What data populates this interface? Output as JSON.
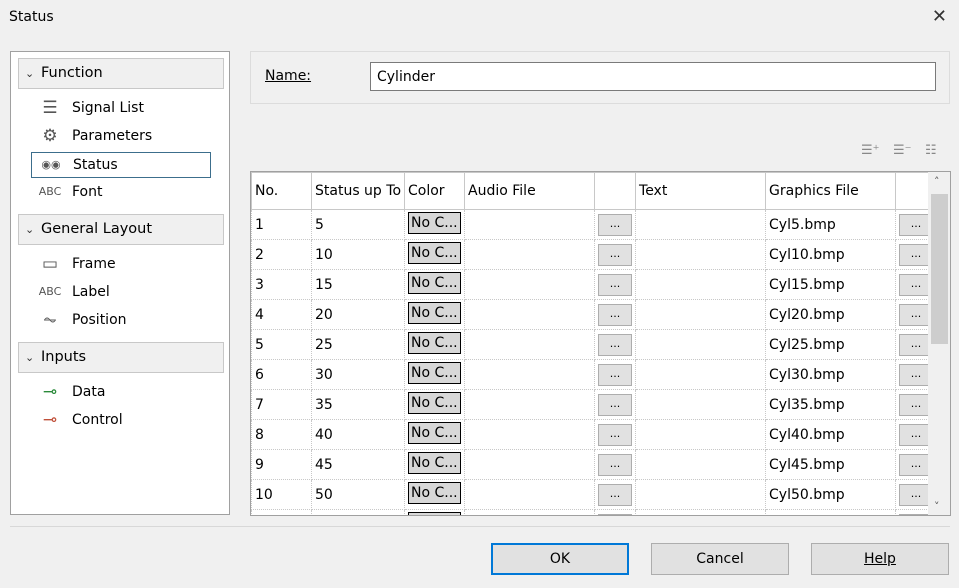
{
  "window": {
    "title": "Status",
    "close": "✕"
  },
  "sidebar": {
    "sections": [
      {
        "label": "Function",
        "items": [
          {
            "label": "Signal List",
            "icon": "list-icon"
          },
          {
            "label": "Parameters",
            "icon": "gear-icon"
          },
          {
            "label": "Status",
            "icon": "status-icon",
            "selected": true
          },
          {
            "label": "Font",
            "icon": "abc-icon"
          }
        ]
      },
      {
        "label": "General Layout",
        "items": [
          {
            "label": "Frame",
            "icon": "frame-icon"
          },
          {
            "label": "Label",
            "icon": "abc-icon"
          },
          {
            "label": "Position",
            "icon": "position-icon"
          }
        ]
      },
      {
        "label": "Inputs",
        "items": [
          {
            "label": "Data",
            "icon": "data-input-icon"
          },
          {
            "label": "Control",
            "icon": "control-input-icon"
          }
        ]
      }
    ]
  },
  "name": {
    "label": "Name:",
    "value": "Cylinder"
  },
  "table": {
    "columns": [
      "No.",
      "Status up To",
      "Color",
      "Audio File",
      "",
      "Text",
      "Graphics File",
      ""
    ],
    "color_label": "No C...",
    "browse_label": "...",
    "rows": [
      [
        "1",
        "5",
        "Cyl5.bmp"
      ],
      [
        "2",
        "10",
        "Cyl10.bmp"
      ],
      [
        "3",
        "15",
        "Cyl15.bmp"
      ],
      [
        "4",
        "20",
        "Cyl20.bmp"
      ],
      [
        "5",
        "25",
        "Cyl25.bmp"
      ],
      [
        "6",
        "30",
        "Cyl30.bmp"
      ],
      [
        "7",
        "35",
        "Cyl35.bmp"
      ],
      [
        "8",
        "40",
        "Cyl40.bmp"
      ],
      [
        "9",
        "45",
        "Cyl45.bmp"
      ],
      [
        "10",
        "50",
        "Cyl50.bmp"
      ],
      [
        "",
        "",
        ""
      ]
    ]
  },
  "buttons": {
    "ok": "OK",
    "cancel": "Cancel",
    "help": "Help"
  }
}
